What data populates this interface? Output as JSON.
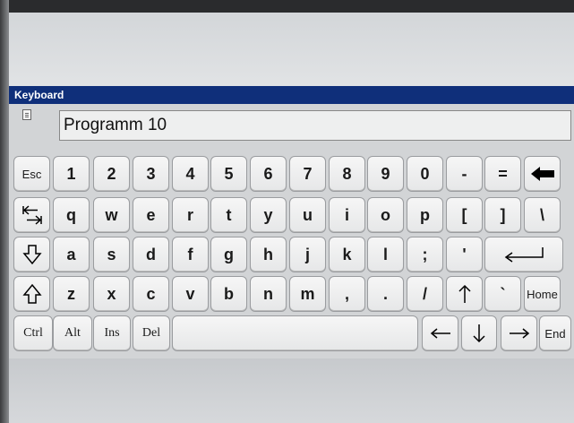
{
  "window": {
    "title": "Keyboard"
  },
  "input": {
    "value": "Programm 10"
  },
  "rows": [
    [
      {
        "label": "Esc",
        "name": "key-esc",
        "small": true
      },
      {
        "label": "1",
        "name": "key-1"
      },
      {
        "label": "2",
        "name": "key-2"
      },
      {
        "label": "3",
        "name": "key-3"
      },
      {
        "label": "4",
        "name": "key-4"
      },
      {
        "label": "5",
        "name": "key-5"
      },
      {
        "label": "6",
        "name": "key-6"
      },
      {
        "label": "7",
        "name": "key-7"
      },
      {
        "label": "8",
        "name": "key-8"
      },
      {
        "label": "9",
        "name": "key-9"
      },
      {
        "label": "0",
        "name": "key-0"
      },
      {
        "label": "-",
        "name": "key-minus"
      },
      {
        "label": "=",
        "name": "key-equals"
      },
      {
        "icon": "backspace-icon",
        "name": "key-backspace"
      }
    ],
    [
      {
        "icon": "tab-icon",
        "name": "key-tab"
      },
      {
        "label": "q",
        "name": "key-q"
      },
      {
        "label": "w",
        "name": "key-w"
      },
      {
        "label": "e",
        "name": "key-e"
      },
      {
        "label": "r",
        "name": "key-r"
      },
      {
        "label": "t",
        "name": "key-t"
      },
      {
        "label": "y",
        "name": "key-y"
      },
      {
        "label": "u",
        "name": "key-u"
      },
      {
        "label": "i",
        "name": "key-i"
      },
      {
        "label": "o",
        "name": "key-o"
      },
      {
        "label": "p",
        "name": "key-p"
      },
      {
        "label": "[",
        "name": "key-left-bracket"
      },
      {
        "label": "]",
        "name": "key-right-bracket"
      },
      {
        "label": "\\",
        "name": "key-backslash"
      }
    ],
    [
      {
        "icon": "caps-lock-icon",
        "name": "key-caps-lock"
      },
      {
        "label": "a",
        "name": "key-a"
      },
      {
        "label": "s",
        "name": "key-s"
      },
      {
        "label": "d",
        "name": "key-d"
      },
      {
        "label": "f",
        "name": "key-f"
      },
      {
        "label": "g",
        "name": "key-g"
      },
      {
        "label": "h",
        "name": "key-h"
      },
      {
        "label": "j",
        "name": "key-j"
      },
      {
        "label": "k",
        "name": "key-k"
      },
      {
        "label": "l",
        "name": "key-l"
      },
      {
        "label": ";",
        "name": "key-semicolon"
      },
      {
        "label": "'",
        "name": "key-apostrophe"
      },
      {
        "icon": "enter-icon",
        "name": "key-enter"
      }
    ],
    [
      {
        "icon": "shift-icon",
        "name": "key-shift"
      },
      {
        "label": "z",
        "name": "key-z"
      },
      {
        "label": "x",
        "name": "key-x"
      },
      {
        "label": "c",
        "name": "key-c"
      },
      {
        "label": "v",
        "name": "key-v"
      },
      {
        "label": "b",
        "name": "key-b"
      },
      {
        "label": "n",
        "name": "key-n"
      },
      {
        "label": "m",
        "name": "key-m"
      },
      {
        "label": ",",
        "name": "key-comma"
      },
      {
        "label": ".",
        "name": "key-period"
      },
      {
        "label": "/",
        "name": "key-slash"
      },
      {
        "icon": "arrow-up-icon",
        "name": "key-arrow-up"
      },
      {
        "label": "`",
        "name": "key-backtick"
      },
      {
        "label": "Home",
        "name": "key-home",
        "small": true
      }
    ],
    [
      {
        "label": "Ctrl",
        "name": "key-ctrl",
        "serif": true
      },
      {
        "label": "Alt",
        "name": "key-alt",
        "serif": true
      },
      {
        "label": "Ins",
        "name": "key-ins",
        "serif": true
      },
      {
        "label": "Del",
        "name": "key-del",
        "serif": true
      },
      {
        "label": "",
        "name": "key-space"
      },
      {
        "icon": "arrow-left-icon",
        "name": "key-arrow-left"
      },
      {
        "icon": "arrow-down-icon",
        "name": "key-arrow-down"
      },
      {
        "icon": "arrow-right-icon",
        "name": "key-arrow-right"
      },
      {
        "label": "End",
        "name": "key-end",
        "small": true
      }
    ]
  ]
}
